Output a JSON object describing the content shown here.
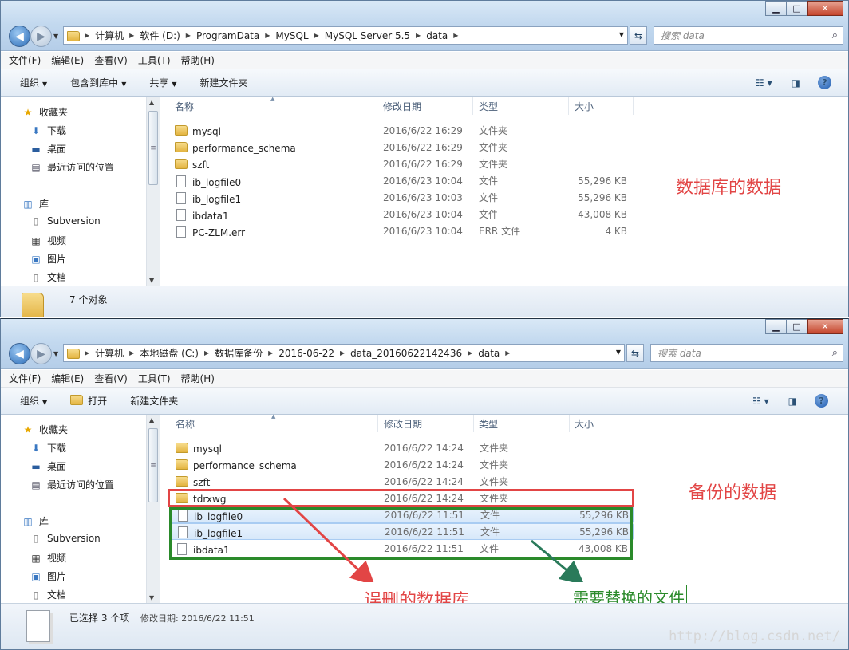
{
  "window1": {
    "breadcrumb": [
      "计算机",
      "软件 (D:)",
      "ProgramData",
      "MySQL",
      "MySQL Server 5.5",
      "data"
    ],
    "search_placeholder": "搜索 data",
    "menu": [
      "文件(F)",
      "编辑(E)",
      "查看(V)",
      "工具(T)",
      "帮助(H)"
    ],
    "toolbar": {
      "organize": "组织",
      "include_in_library": "包含到库中",
      "share": "共享",
      "new_folder": "新建文件夹"
    },
    "columns": {
      "name": "名称",
      "date": "修改日期",
      "type": "类型",
      "size": "大小"
    },
    "files": [
      {
        "name": "mysql",
        "date": "2016/6/22 16:29",
        "type": "文件夹",
        "size": "",
        "kind": "folder"
      },
      {
        "name": "performance_schema",
        "date": "2016/6/22 16:29",
        "type": "文件夹",
        "size": "",
        "kind": "folder"
      },
      {
        "name": "szft",
        "date": "2016/6/22 16:29",
        "type": "文件夹",
        "size": "",
        "kind": "folder"
      },
      {
        "name": "ib_logfile0",
        "date": "2016/6/23 10:04",
        "type": "文件",
        "size": "55,296 KB",
        "kind": "file"
      },
      {
        "name": "ib_logfile1",
        "date": "2016/6/23 10:03",
        "type": "文件",
        "size": "55,296 KB",
        "kind": "file"
      },
      {
        "name": "ibdata1",
        "date": "2016/6/23 10:04",
        "type": "文件",
        "size": "43,008 KB",
        "kind": "file"
      },
      {
        "name": "PC-ZLM.err",
        "date": "2016/6/23 10:04",
        "type": "ERR 文件",
        "size": "4 KB",
        "kind": "file"
      }
    ],
    "status": "7 个对象",
    "annotation": "数据库的数据"
  },
  "window2": {
    "breadcrumb": [
      "计算机",
      "本地磁盘 (C:)",
      "数据库备份",
      "2016-06-22",
      "data_20160622142436",
      "data"
    ],
    "search_placeholder": "搜索 data",
    "menu": [
      "文件(F)",
      "编辑(E)",
      "查看(V)",
      "工具(T)",
      "帮助(H)"
    ],
    "toolbar": {
      "organize": "组织",
      "open": "打开",
      "new_folder": "新建文件夹"
    },
    "columns": {
      "name": "名称",
      "date": "修改日期",
      "type": "类型",
      "size": "大小"
    },
    "files": [
      {
        "name": "mysql",
        "date": "2016/6/22 14:24",
        "type": "文件夹",
        "size": "",
        "kind": "folder",
        "selected": false
      },
      {
        "name": "performance_schema",
        "date": "2016/6/22 14:24",
        "type": "文件夹",
        "size": "",
        "kind": "folder",
        "selected": false
      },
      {
        "name": "szft",
        "date": "2016/6/22 14:24",
        "type": "文件夹",
        "size": "",
        "kind": "folder",
        "selected": false
      },
      {
        "name": "tdrxwg",
        "date": "2016/6/22 14:24",
        "type": "文件夹",
        "size": "",
        "kind": "folder",
        "selected": true
      },
      {
        "name": "ib_logfile0",
        "date": "2016/6/22 11:51",
        "type": "文件",
        "size": "55,296 KB",
        "kind": "file",
        "selected": true
      },
      {
        "name": "ib_logfile1",
        "date": "2016/6/22 11:51",
        "type": "文件",
        "size": "55,296 KB",
        "kind": "file",
        "selected": true
      },
      {
        "name": "ibdata1",
        "date": "2016/6/22 11:51",
        "type": "文件",
        "size": "43,008 KB",
        "kind": "file",
        "selected": false
      }
    ],
    "status_selected": "已选择 3 个项",
    "status_date": "修改日期: 2016/6/22 11:51",
    "annotation_backup": "备份的数据",
    "annotation_deleted": "误删的数据库",
    "annotation_replace": "需要替换的文件"
  },
  "nav_pane": {
    "favorites": "收藏夹",
    "downloads": "下载",
    "desktop": "桌面",
    "recent": "最近访问的位置",
    "libraries": "库",
    "subversion": "Subversion",
    "videos": "视频",
    "pictures": "图片",
    "documents": "文档"
  },
  "window_buttons": {
    "minimize": "▁",
    "maximize": "□",
    "close": "✕"
  },
  "watermark": "http://blog.csdn.net/",
  "colors": {
    "highlight_red": "#e24545",
    "highlight_green": "#2a8a2a",
    "selection": "#d7e8fa"
  }
}
